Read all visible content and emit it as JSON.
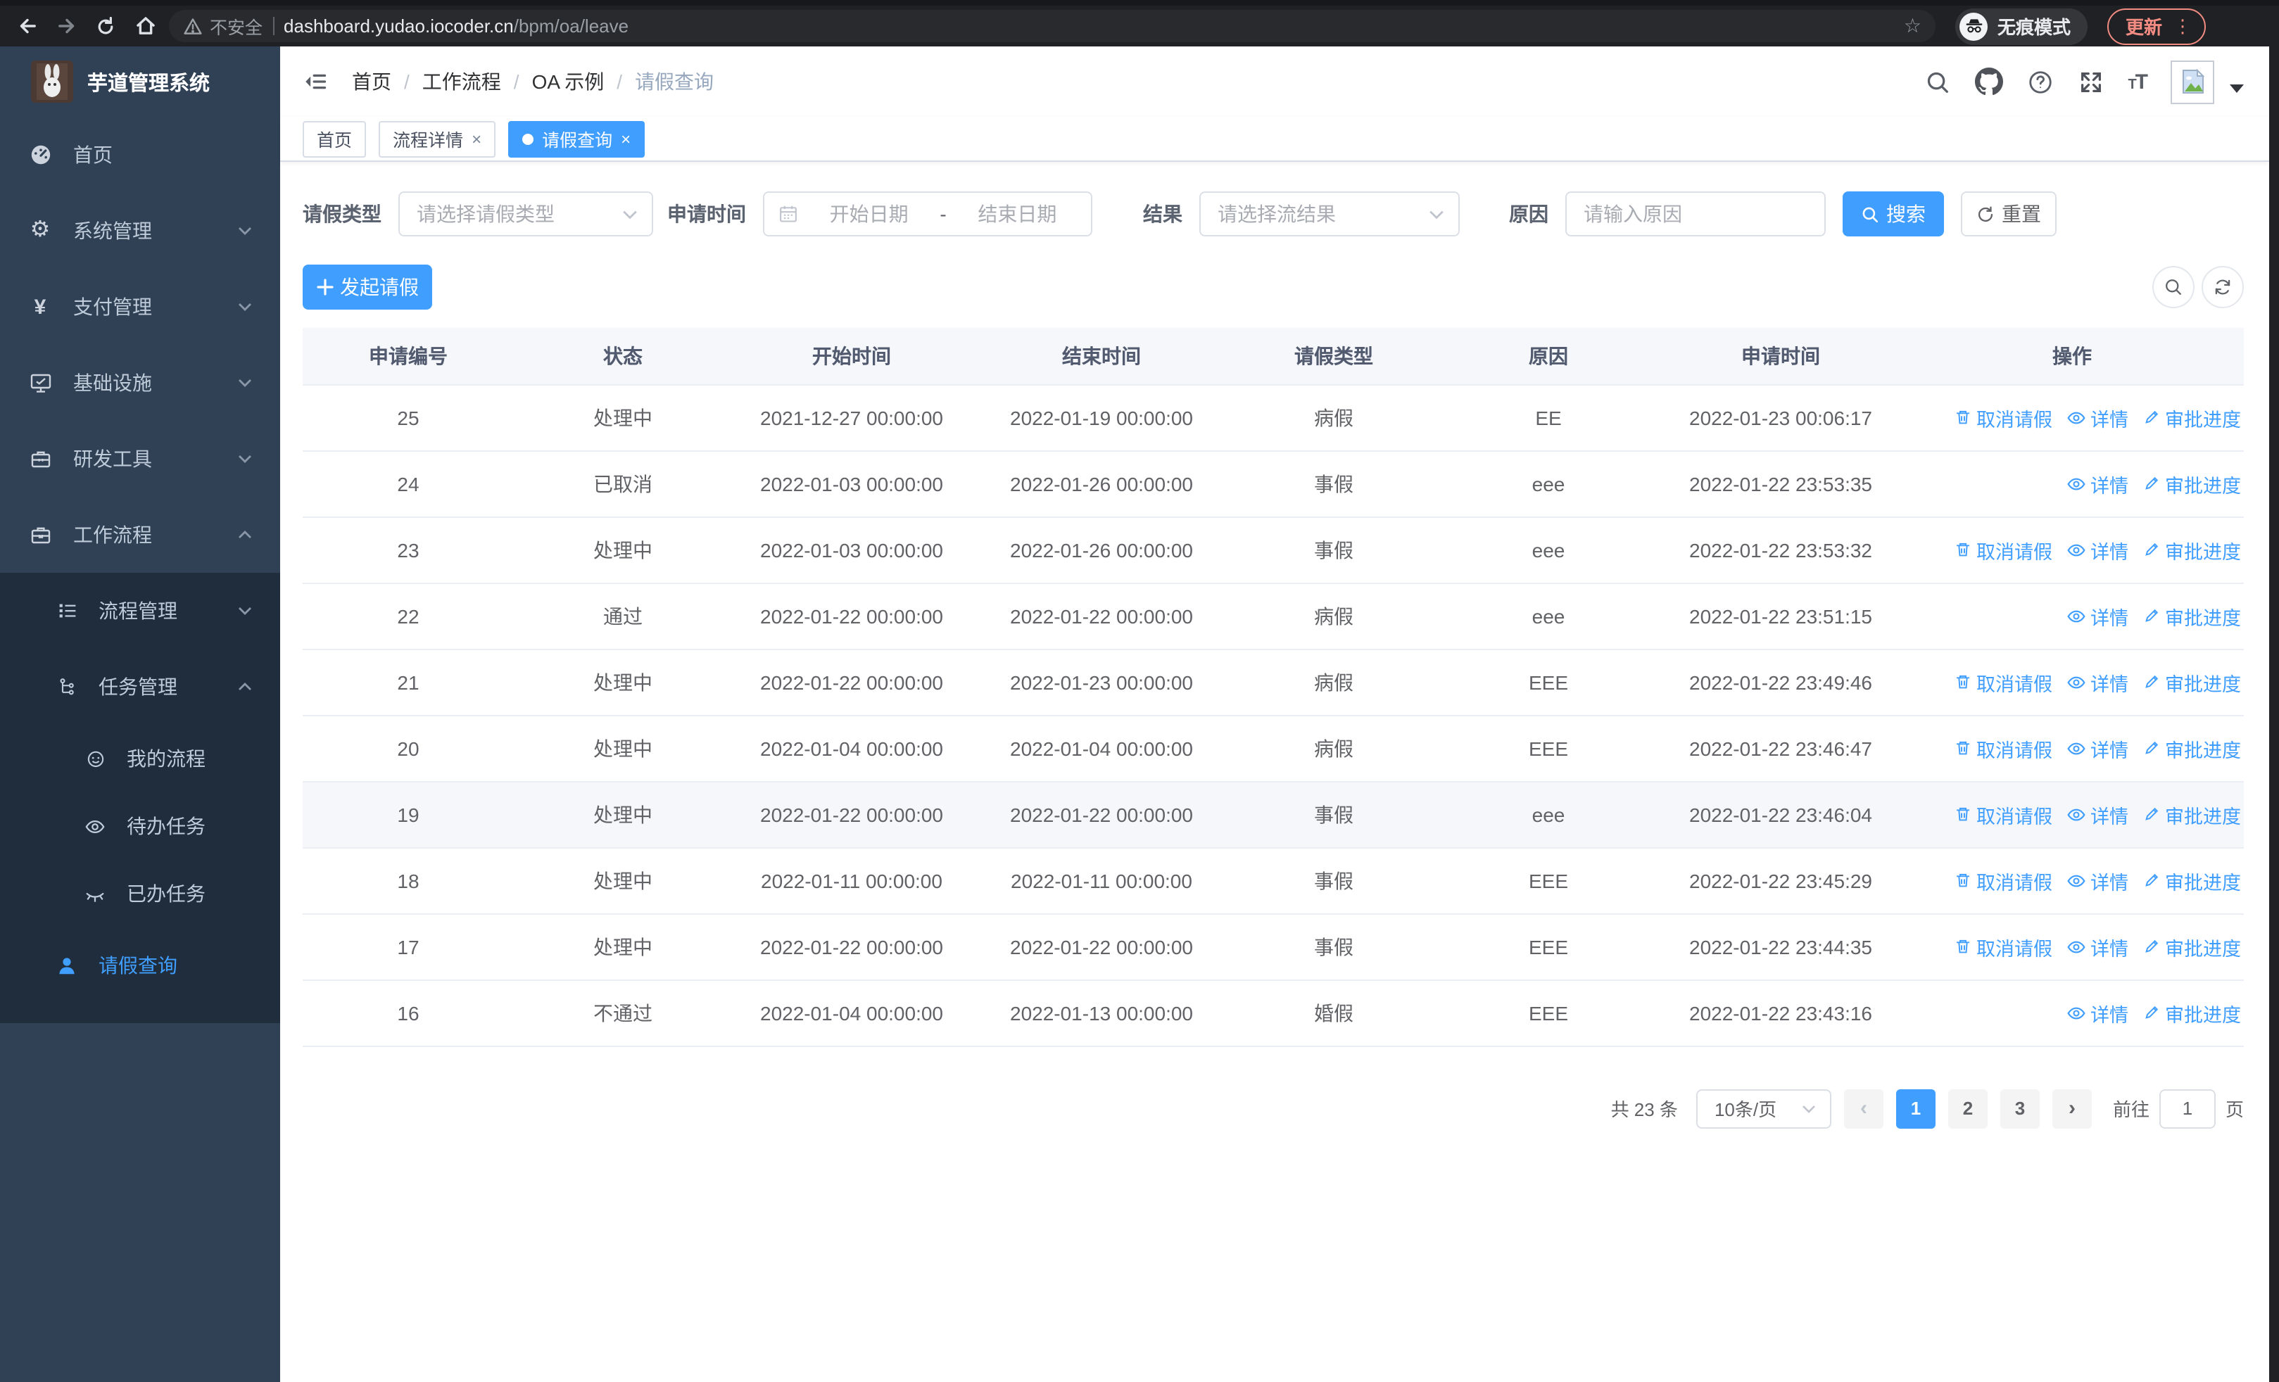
{
  "browser": {
    "security_label": "不安全",
    "url_host": "dashboard.yudao.iocoder.cn",
    "url_path": "/bpm/oa/leave",
    "incognito_label": "无痕模式",
    "update_label": "更新",
    "menu_dots": "⋮"
  },
  "sidebar": {
    "title": "芋道管理系统",
    "items": [
      "首页",
      "系统管理",
      "支付管理",
      "基础设施",
      "研发工具",
      "工作流程"
    ],
    "submenu": [
      "流程管理",
      "任务管理"
    ],
    "task_children": [
      "我的流程",
      "待办任务",
      "已办任务"
    ],
    "active_item": "请假查询"
  },
  "breadcrumb": {
    "items": [
      "首页",
      "工作流程",
      "OA 示例",
      "请假查询"
    ],
    "separator": "/"
  },
  "tabs": [
    {
      "label": "首页",
      "active": false,
      "closable": false
    },
    {
      "label": "流程详情",
      "active": false,
      "closable": true
    },
    {
      "label": "请假查询",
      "active": true,
      "closable": true
    }
  ],
  "filters": {
    "leave_type_label": "请假类型",
    "leave_type_placeholder": "请选择请假类型",
    "apply_time_label": "申请时间",
    "start_placeholder": "开始日期",
    "range_separator": "-",
    "end_placeholder": "结束日期",
    "result_label": "结果",
    "result_placeholder": "请选择流结果",
    "reason_label": "原因",
    "reason_placeholder": "请输入原因",
    "search_label": "搜索",
    "reset_label": "重置"
  },
  "toolbar": {
    "create_label": "发起请假"
  },
  "table": {
    "headers": [
      "申请编号",
      "状态",
      "开始时间",
      "结束时间",
      "请假类型",
      "原因",
      "申请时间",
      "操作"
    ],
    "action_labels": {
      "cancel": "取消请假",
      "detail": "详情",
      "progress": "审批进度"
    },
    "rows": [
      {
        "id": "25",
        "status": "处理中",
        "start": "2021-12-27 00:00:00",
        "end": "2022-01-19 00:00:00",
        "type": "病假",
        "reason": "EE",
        "apply_time": "2022-01-23 00:06:17",
        "actions": [
          "cancel",
          "detail",
          "progress"
        ]
      },
      {
        "id": "24",
        "status": "已取消",
        "start": "2022-01-03 00:00:00",
        "end": "2022-01-26 00:00:00",
        "type": "事假",
        "reason": "eee",
        "apply_time": "2022-01-22 23:53:35",
        "actions": [
          "detail",
          "progress"
        ]
      },
      {
        "id": "23",
        "status": "处理中",
        "start": "2022-01-03 00:00:00",
        "end": "2022-01-26 00:00:00",
        "type": "事假",
        "reason": "eee",
        "apply_time": "2022-01-22 23:53:32",
        "actions": [
          "cancel",
          "detail",
          "progress"
        ]
      },
      {
        "id": "22",
        "status": "通过",
        "start": "2022-01-22 00:00:00",
        "end": "2022-01-22 00:00:00",
        "type": "病假",
        "reason": "eee",
        "apply_time": "2022-01-22 23:51:15",
        "actions": [
          "detail",
          "progress"
        ]
      },
      {
        "id": "21",
        "status": "处理中",
        "start": "2022-01-22 00:00:00",
        "end": "2022-01-23 00:00:00",
        "type": "病假",
        "reason": "EEE",
        "apply_time": "2022-01-22 23:49:46",
        "actions": [
          "cancel",
          "detail",
          "progress"
        ]
      },
      {
        "id": "20",
        "status": "处理中",
        "start": "2022-01-04 00:00:00",
        "end": "2022-01-04 00:00:00",
        "type": "病假",
        "reason": "EEE",
        "apply_time": "2022-01-22 23:46:47",
        "actions": [
          "cancel",
          "detail",
          "progress"
        ]
      },
      {
        "id": "19",
        "status": "处理中",
        "start": "2022-01-22 00:00:00",
        "end": "2022-01-22 00:00:00",
        "type": "事假",
        "reason": "eee",
        "apply_time": "2022-01-22 23:46:04",
        "actions": [
          "cancel",
          "detail",
          "progress"
        ],
        "highlight": true
      },
      {
        "id": "18",
        "status": "处理中",
        "start": "2022-01-11 00:00:00",
        "end": "2022-01-11 00:00:00",
        "type": "事假",
        "reason": "EEE",
        "apply_time": "2022-01-22 23:45:29",
        "actions": [
          "cancel",
          "detail",
          "progress"
        ]
      },
      {
        "id": "17",
        "status": "处理中",
        "start": "2022-01-22 00:00:00",
        "end": "2022-01-22 00:00:00",
        "type": "事假",
        "reason": "EEE",
        "apply_time": "2022-01-22 23:44:35",
        "actions": [
          "cancel",
          "detail",
          "progress"
        ]
      },
      {
        "id": "16",
        "status": "不通过",
        "start": "2022-01-04 00:00:00",
        "end": "2022-01-13 00:00:00",
        "type": "婚假",
        "reason": "EEE",
        "apply_time": "2022-01-22 23:43:16",
        "actions": [
          "detail",
          "progress"
        ]
      }
    ]
  },
  "pagination": {
    "total_label": "共 23 条",
    "page_size_label": "10条/页",
    "pages": [
      1,
      2,
      3
    ],
    "active_page": 1,
    "goto_label": "前往",
    "goto_value": "1",
    "unit_label": "页"
  },
  "colors": {
    "accent": "#409eff",
    "sidebar_bg": "#304156",
    "submenu_bg": "#1f2d3d",
    "update_accent": "#f28b82"
  }
}
